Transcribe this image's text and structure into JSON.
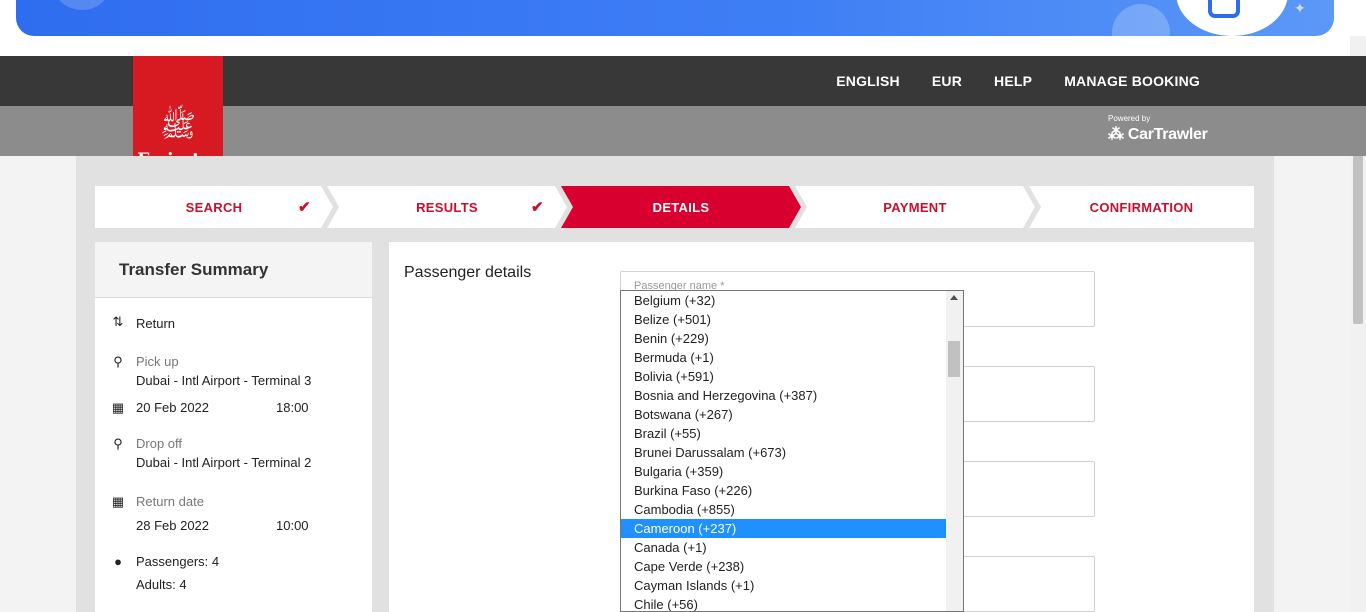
{
  "header": {
    "nav": [
      "ENGLISH",
      "EUR",
      "HELP",
      "MANAGE BOOKING"
    ],
    "logo_text": "Emirates",
    "powered_by": "Powered by",
    "partner": "CarTrawler"
  },
  "steps": [
    {
      "label": "SEARCH",
      "done": true
    },
    {
      "label": "RESULTS",
      "done": true
    },
    {
      "label": "DETAILS",
      "active": true
    },
    {
      "label": "PAYMENT"
    },
    {
      "label": "CONFIRMATION"
    }
  ],
  "summary": {
    "title": "Transfer Summary",
    "trip_type": "Return",
    "pickup_label": "Pick up",
    "pickup_location": "Dubai - Intl Airport - Terminal 3",
    "pickup_date": "20 Feb 2022",
    "pickup_time": "18:00",
    "dropoff_label": "Drop off",
    "dropoff_location": "Dubai - Intl Airport - Terminal 2",
    "return_label": "Return date",
    "return_date": "28 Feb 2022",
    "return_time": "10:00",
    "passengers": "Passengers: 4",
    "adults": "Adults: 4"
  },
  "passenger": {
    "title": "Passenger details",
    "name_placeholder": "Passenger name *"
  },
  "dropdown": {
    "selected": "Cameroon (+237)",
    "options": [
      "Belgium (+32)",
      "Belize (+501)",
      "Benin (+229)",
      "Bermuda (+1)",
      "Bolivia (+591)",
      "Bosnia and Herzegovina (+387)",
      "Botswana (+267)",
      "Brazil (+55)",
      "Brunei Darussalam (+673)",
      "Bulgaria (+359)",
      "Burkina Faso (+226)",
      "Cambodia (+855)",
      "Cameroon (+237)",
      "Canada (+1)",
      "Cape Verde (+238)",
      "Cayman Islands (+1)",
      "Chile (+56)"
    ]
  },
  "colors": {
    "brand_red": "#d71921",
    "step_red": "#c8102e",
    "select_blue": "#1e90ff"
  }
}
